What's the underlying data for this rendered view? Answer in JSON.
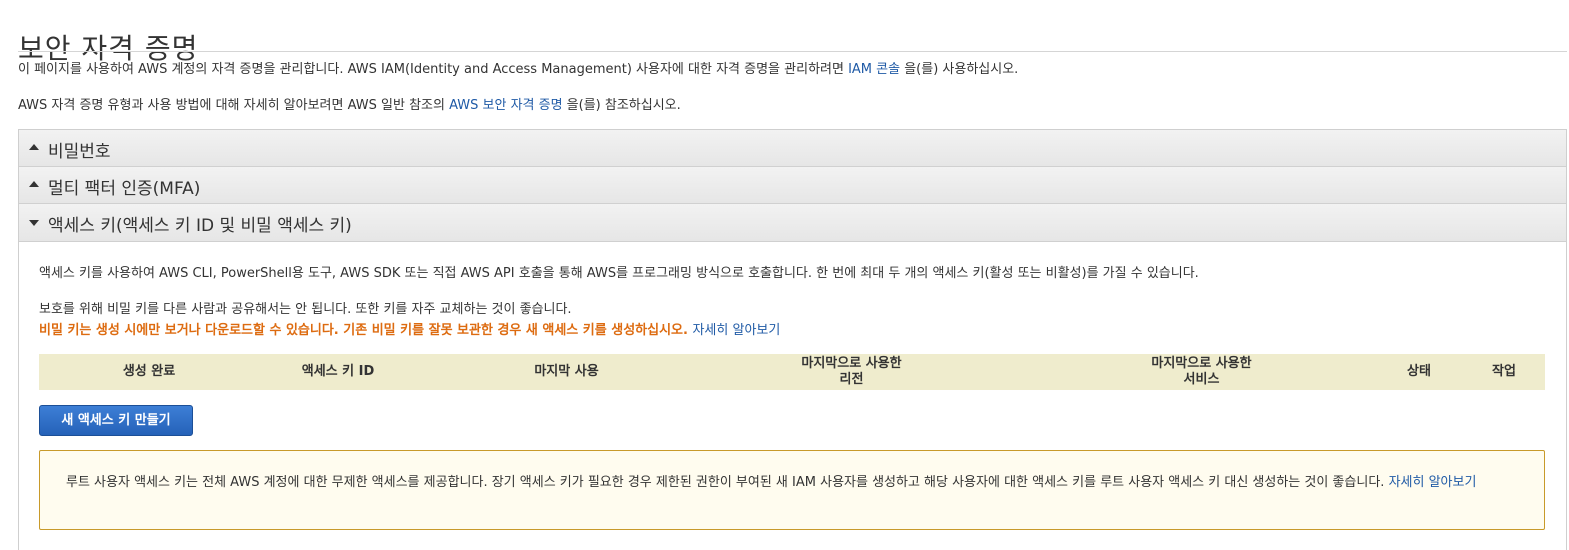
{
  "page": {
    "title": "보안 자격 증명",
    "intro1_pre": "이 페이지를 사용하여 AWS 계정의 자격 증명을 관리합니다. AWS IAM(Identity and Access Management) 사용자에 대한 자격 증명을 관리하려면 ",
    "intro1_link": "IAM 콘솔",
    "intro1_post": " 을(를) 사용하십시오.",
    "intro2_pre": "AWS 자격 증명 유형과 사용 방법에 대해 자세히 알아보려면 AWS 일반 참조의 ",
    "intro2_link": "AWS 보안 자격 증명",
    "intro2_post": " 을(를) 참조하십시오."
  },
  "sections": {
    "password": "비밀번호",
    "mfa": "멀티 팩터 인증(MFA)",
    "access_keys": "액세스 키(액세스 키 ID 및 비밀 액세스 키)"
  },
  "access_keys": {
    "desc1": "액세스 키를 사용하여 AWS CLI, PowerShell용 도구, AWS SDK 또는 직접 AWS API 호출을 통해 AWS를 프로그래밍 방식으로 호출합니다. 한 번에 최대 두 개의 액세스 키(활성 또는 비활성)를 가질 수 있습니다.",
    "desc2": "보호를 위해 비밀 키를 다른 사람과 공유해서는 안 됩니다. 또한 키를 자주 교체하는 것이 좋습니다.",
    "warning": "비밀 키는 생성 시에만 보거나 다운로드할 수 있습니다. 기존 비밀 키를 잘못 보관한 경우 새 액세스 키를 생성하십시오.",
    "warning_link": "자세히 알아보기",
    "columns": {
      "created": "생성 완료",
      "key_id": "액세스 키 ID",
      "last_used": "마지막 사용",
      "last_region_l1": "마지막으로 사용한",
      "last_region_l2": "리전",
      "last_service_l1": "마지막으로 사용한",
      "last_service_l2": "서비스",
      "status": "상태",
      "actions": "작업"
    },
    "create_button": "새 액세스 키 만들기",
    "notice": "루트 사용자 액세스 키는 전체 AWS 계정에 대한 무제한 액세스를 제공합니다. 장기 액세스 키가 필요한 경우 제한된 권한이 부여된 새 IAM 사용자를 생성하고 해당 사용자에 대한 액세스 키를 루트 사용자 액세스 키 대신 생성하는 것이 좋습니다.",
    "notice_link": "자세히 알아보기"
  },
  "colors": {
    "link": "#1f5aa6",
    "warning": "#dd6b10",
    "table_header_bg": "#efeccd",
    "button_bg": "#2562b8",
    "notice_border": "#c89a2a"
  }
}
